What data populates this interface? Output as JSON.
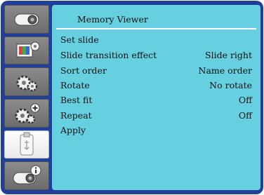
{
  "sidebar": {
    "tabs": [
      {
        "icon": "projector-icon",
        "active": false
      },
      {
        "icon": "display-settings-icon",
        "active": false
      },
      {
        "icon": "gears-icon",
        "active": false
      },
      {
        "icon": "gears-plus-icon",
        "active": false
      },
      {
        "icon": "usb-drive-icon",
        "active": true
      },
      {
        "icon": "projector-info-icon",
        "active": false
      }
    ]
  },
  "panel": {
    "title": "Memory Viewer",
    "items": [
      {
        "label": "Set slide",
        "value": ""
      },
      {
        "label": "Slide transition effect",
        "value": "Slide right"
      },
      {
        "label": "Sort order",
        "value": "Name order"
      },
      {
        "label": "Rotate",
        "value": "No rotate"
      },
      {
        "label": "Best fit",
        "value": "Off"
      },
      {
        "label": "Repeat",
        "value": "Off"
      },
      {
        "label": "Apply",
        "value": ""
      }
    ]
  },
  "colors": {
    "frame": "#1f3f9a",
    "panel": "#66cfe0",
    "tab_inactive": "#7a7a7a",
    "tab_active": "#ffffff"
  }
}
